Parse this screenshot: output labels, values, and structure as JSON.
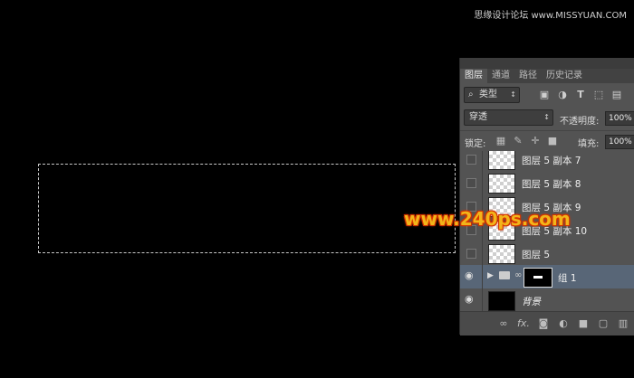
{
  "watermark": "思缘设计论坛 www.MISSYUAN.COM",
  "overlay_brand": "www.240ps.com",
  "panel": {
    "tabs": [
      "图层",
      "通道",
      "路径",
      "历史记录"
    ],
    "active_tab": "图层",
    "filter": {
      "icon": "search-icon",
      "label": "类型"
    },
    "filter_icons": [
      "image-filter-icon",
      "adjustment-filter-icon",
      "type-filter-icon",
      "shape-filter-icon",
      "smart-object-filter-icon"
    ],
    "blend_mode": "穿透",
    "opacity_label": "不透明度:",
    "opacity_value": "100%",
    "lock_label": "锁定:",
    "lock_icons": [
      "lock-transparent-icon",
      "lock-image-icon",
      "lock-position-icon",
      "lock-all-icon"
    ],
    "fill_label": "填充:",
    "fill_value": "100%",
    "layers": [
      {
        "name": "图层 5 副本 7",
        "visible": false,
        "thumb": "transparent"
      },
      {
        "name": "图层 5 副本 8",
        "visible": false,
        "thumb": "transparent"
      },
      {
        "name": "图层 5 副本 9",
        "visible": false,
        "thumb": "transparent"
      },
      {
        "name": "图层 5 副本 10",
        "visible": false,
        "thumb": "transparent"
      },
      {
        "name": "图层 5",
        "visible": false,
        "thumb": "transparent"
      },
      {
        "name": "组 1",
        "visible": true,
        "type": "group",
        "selected": true
      },
      {
        "name": "背景",
        "visible": true,
        "thumb": "black",
        "italic": true
      }
    ],
    "bottom_icons": [
      "link-layers-icon",
      "fx-icon",
      "add-mask-icon",
      "adjustment-layer-icon",
      "new-group-icon",
      "new-layer-icon",
      "trash-icon"
    ],
    "fx_label": "fx."
  }
}
